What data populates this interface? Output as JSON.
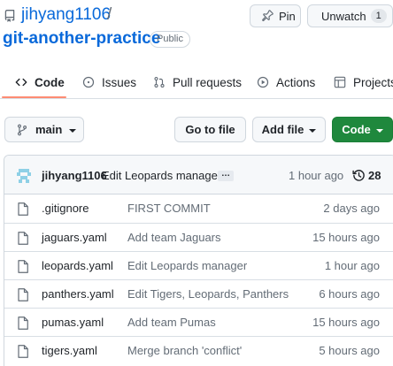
{
  "repo": {
    "owner": "jihyang1106",
    "separator": "/",
    "name": "git-another-practice",
    "visibility": "Public"
  },
  "actions": {
    "pin_label": "Pin",
    "watch_label": "Unwatch",
    "watch_count": "1"
  },
  "tabs": [
    {
      "label": "Code",
      "icon": "code-icon",
      "active": true
    },
    {
      "label": "Issues",
      "icon": "issue-icon"
    },
    {
      "label": "Pull requests",
      "icon": "pull-request-icon"
    },
    {
      "label": "Actions",
      "icon": "play-icon"
    },
    {
      "label": "Projects",
      "icon": "table-icon"
    }
  ],
  "toolbar": {
    "branch": "main",
    "go_to_file": "Go to file",
    "add_file": "Add file",
    "code": "Code"
  },
  "latest_commit": {
    "author": "jihyang1106",
    "message": "Edit Leopards manager",
    "ellipsis": "…",
    "time": "1 hour ago",
    "count": "28"
  },
  "files": [
    {
      "name": ".gitignore",
      "commit": "FIRST COMMIT",
      "time": "2 days ago"
    },
    {
      "name": "jaguars.yaml",
      "commit": "Add team Jaguars",
      "time": "15 hours ago"
    },
    {
      "name": "leopards.yaml",
      "commit": "Edit Leopards manager",
      "time": "1 hour ago"
    },
    {
      "name": "panthers.yaml",
      "commit": "Edit Tigers, Leopards, Panthers",
      "time": "6 hours ago"
    },
    {
      "name": "pumas.yaml",
      "commit": "Add team Pumas",
      "time": "15 hours ago"
    },
    {
      "name": "tigers.yaml",
      "commit": "Merge branch 'conflict'",
      "time": "5 hours ago"
    }
  ],
  "colors": {
    "link": "#0969da",
    "primary_button": "#1f883d",
    "active_tab_underline": "#fd8c73",
    "muted_text": "#636c76"
  }
}
